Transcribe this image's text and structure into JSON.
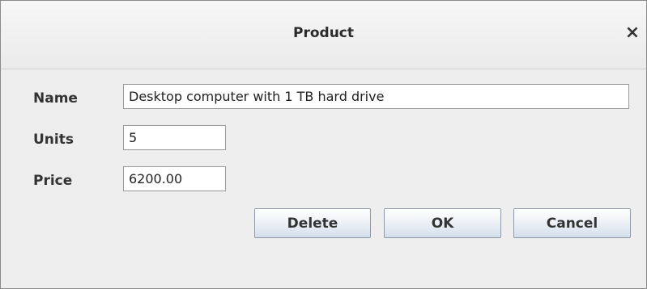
{
  "dialog": {
    "title": "Product",
    "close_glyph": "×"
  },
  "form": {
    "name_label": "Name",
    "name_value": "Desktop computer with 1 TB hard drive",
    "units_label": "Units",
    "units_value": "5",
    "price_label": "Price",
    "price_value": "6200.00"
  },
  "buttons": {
    "delete_label": "Delete",
    "ok_label": "OK",
    "cancel_label": "Cancel"
  },
  "icons": {
    "close": "close-icon"
  }
}
